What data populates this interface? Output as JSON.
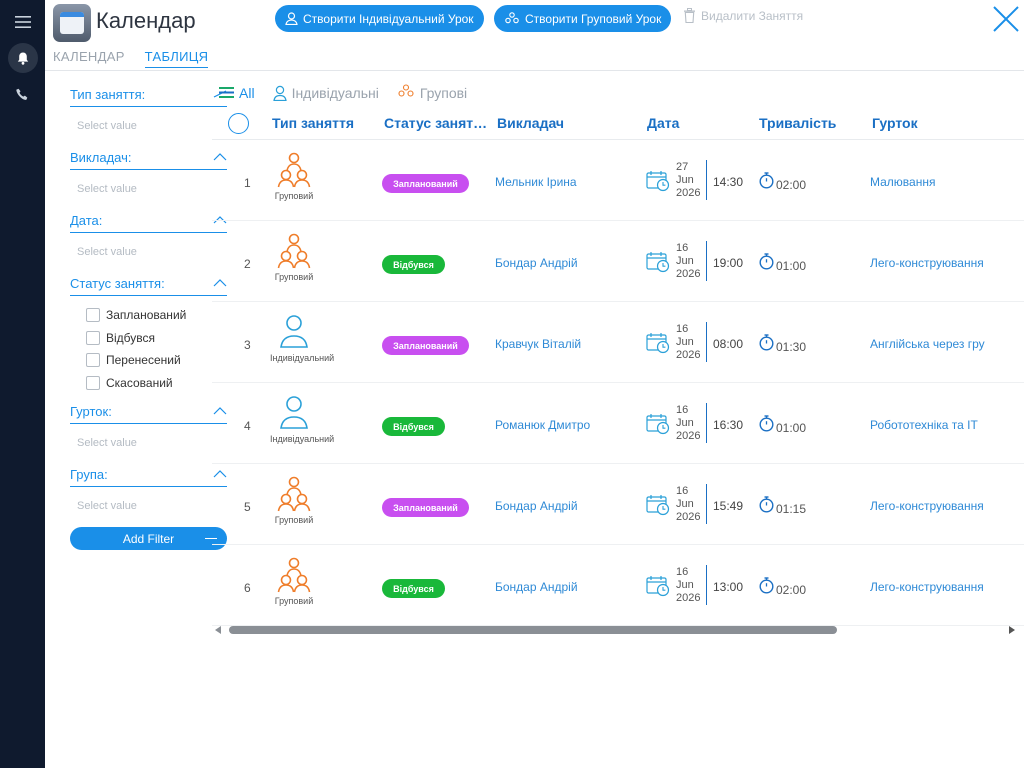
{
  "app": {
    "title": "Календар"
  },
  "toolbar": {
    "create_individual": "Створити Індивідуальний Урок",
    "create_group": "Створити Груповий Урок",
    "delete": "Видалити Заняття"
  },
  "tabs": [
    {
      "label": "КАЛЕНДАР"
    },
    {
      "label": "ТАБЛИЦЯ",
      "active": true
    }
  ],
  "filters": {
    "type": {
      "label": "Тип заняття:",
      "placeholder": "Select value"
    },
    "teacher": {
      "label": "Викладач:",
      "placeholder": "Select value"
    },
    "date": {
      "label": "Дата:",
      "placeholder": "Select value"
    },
    "status": {
      "label": "Статус заняття:",
      "options": [
        "Запланований",
        "Відбувся",
        "Перенесений",
        "Скасований"
      ]
    },
    "club": {
      "label": "Гурток:",
      "placeholder": "Select value"
    },
    "group": {
      "label": "Група:",
      "placeholder": "Select value"
    },
    "add_filter": "Add Filter"
  },
  "view_tabs": [
    {
      "label": "All",
      "active": true
    },
    {
      "label": "Індивідуальні"
    },
    {
      "label": "Групові"
    }
  ],
  "table": {
    "columns": [
      "Тип заняття",
      "Статус занят…",
      "Викладач",
      "Дата",
      "Тривалість",
      "Гурток"
    ],
    "rows": [
      {
        "num": "1",
        "type": "Груповий",
        "type_kind": "group",
        "status": "Запланований",
        "status_kind": "planned",
        "teacher": "Мельник Ірина",
        "day": "27",
        "month": "Jun",
        "year": "2026",
        "time": "14:30",
        "duration": "02:00",
        "club": "Малювання"
      },
      {
        "num": "2",
        "type": "Груповий",
        "type_kind": "group",
        "status": "Відбувся",
        "status_kind": "done",
        "teacher": "Бондар Андрій",
        "day": "16",
        "month": "Jun",
        "year": "2026",
        "time": "19:00",
        "duration": "01:00",
        "club": "Лего-конструювання"
      },
      {
        "num": "3",
        "type": "Індивідуальний",
        "type_kind": "individual",
        "status": "Запланований",
        "status_kind": "planned",
        "teacher": "Кравчук Віталій",
        "day": "16",
        "month": "Jun",
        "year": "2026",
        "time": "08:00",
        "duration": "01:30",
        "club": "Англійська через гру"
      },
      {
        "num": "4",
        "type": "Індивідуальний",
        "type_kind": "individual",
        "status": "Відбувся",
        "status_kind": "done",
        "teacher": "Романюк Дмитро",
        "day": "16",
        "month": "Jun",
        "year": "2026",
        "time": "16:30",
        "duration": "01:00",
        "club": "Робототехніка та ІТ"
      },
      {
        "num": "5",
        "type": "Груповий",
        "type_kind": "group",
        "status": "Запланований",
        "status_kind": "planned",
        "teacher": "Бондар Андрій",
        "day": "16",
        "month": "Jun",
        "year": "2026",
        "time": "15:49",
        "duration": "01:15",
        "club": "Лего-конструювання"
      },
      {
        "num": "6",
        "type": "Груповий",
        "type_kind": "group",
        "status": "Відбувся",
        "status_kind": "done",
        "teacher": "Бондар Андрій",
        "day": "16",
        "month": "Jun",
        "year": "2026",
        "time": "13:00",
        "duration": "02:00",
        "club": "Лего-конструювання"
      }
    ]
  },
  "colors": {
    "accent": "#1a8fe8",
    "planned": "#c84ff0",
    "done": "#19b83a",
    "group_icon": "#ef7d2a",
    "individual_icon": "#2aa0d8",
    "sidebar": "#0f1a2e"
  },
  "icons": {
    "menu": "hamburger-icon",
    "notifications": "bell-icon",
    "phone": "phone-icon",
    "calendar": "calendar-app-icon",
    "close": "close-icon",
    "trash": "trash-icon"
  }
}
